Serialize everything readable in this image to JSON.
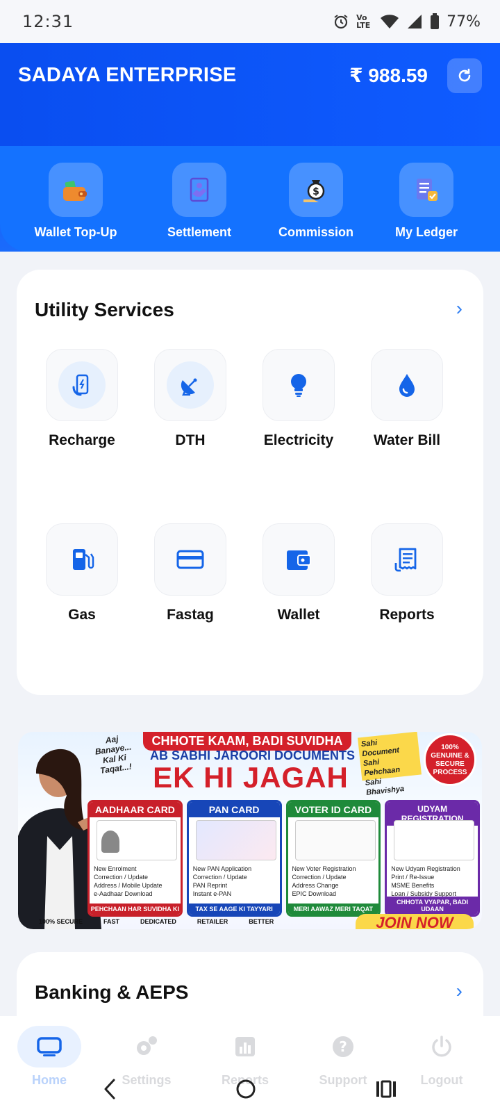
{
  "status_bar": {
    "time": "12:31",
    "network": "Vo LTE",
    "battery": "77%"
  },
  "header": {
    "brand": "SADAYA ENTERPRISE",
    "balance": "₹ 988.59"
  },
  "quick_actions": [
    {
      "label": "Wallet Top-Up",
      "icon": "wallet-topup-icon"
    },
    {
      "label": "Settlement",
      "icon": "settlement-icon"
    },
    {
      "label": "Commission",
      "icon": "commission-icon"
    },
    {
      "label": "My Ledger",
      "icon": "ledger-icon"
    }
  ],
  "utility": {
    "title": "Utility Services",
    "items": [
      {
        "label": "Recharge",
        "icon": "phone-recharge-icon"
      },
      {
        "label": "DTH",
        "icon": "dish-antenna-icon"
      },
      {
        "label": "Electricity",
        "icon": "bulb-icon"
      },
      {
        "label": "Water Bill",
        "icon": "water-drop-icon"
      },
      {
        "label": "Gas",
        "icon": "gas-pump-icon"
      },
      {
        "label": "Fastag",
        "icon": "card-icon"
      },
      {
        "label": "Wallet",
        "icon": "wallet-icon"
      },
      {
        "label": "Reports",
        "icon": "receipt-icon"
      }
    ]
  },
  "banner": {
    "top_line": "CHHOTE KAAM, BADI SUVIDHA",
    "line2": "AB SABHI JAROORI DOCUMENTS",
    "headline": "EK HI JAGAH",
    "left_tag": "Aaj Banaye... Kal Ki Taqat...!",
    "right_tag": "Sahi Document Sahi Pehchaan Sahi Bhavishya",
    "seal": "100% GENUINE & SECURE PROCESS",
    "cards": [
      {
        "title": "AADHAAR CARD",
        "color": "#c8202a",
        "lines": [
          "New Enrolment",
          "Correction / Update",
          "Address / Mobile Update",
          "e-Aadhaar Download"
        ],
        "footer": "PEHCHAAN HAR SUVIDHA KI"
      },
      {
        "title": "PAN CARD",
        "color": "#1746b8",
        "lines": [
          "New PAN Application",
          "Correction / Update",
          "PAN Reprint",
          "Instant e-PAN"
        ],
        "footer": "TAX SE AAGE KI TAYYARI"
      },
      {
        "title": "VOTER ID CARD",
        "color": "#1f8a3a",
        "lines": [
          "New Voter Registration",
          "Correction / Update",
          "Address Change",
          "EPIC Download"
        ],
        "footer": "MERI AAWAZ MERI TAQAT"
      },
      {
        "title": "UDYAM REGISTRATION",
        "color": "#6b2aa8",
        "lines": [
          "New Udyam Registration",
          "Print / Re-Issue",
          "MSME Benefits",
          "Loan / Subsidy Support"
        ],
        "footer": "CHHOTA VYAPAR, BADI UDAAN"
      }
    ],
    "bottom": [
      "100% SECURE",
      "FAST",
      "DEDICATED",
      "RETAILER",
      "BETTER"
    ],
    "cta": "JOIN NOW"
  },
  "banking": {
    "title": "Banking & AEPS"
  },
  "bottom_nav": [
    {
      "label": "Home",
      "icon": "monitor-icon"
    },
    {
      "label": "Settings",
      "icon": "gears-icon"
    },
    {
      "label": "Reports",
      "icon": "chart-icon"
    },
    {
      "label": "Support",
      "icon": "help-icon"
    },
    {
      "label": "Logout",
      "icon": "power-icon"
    }
  ]
}
